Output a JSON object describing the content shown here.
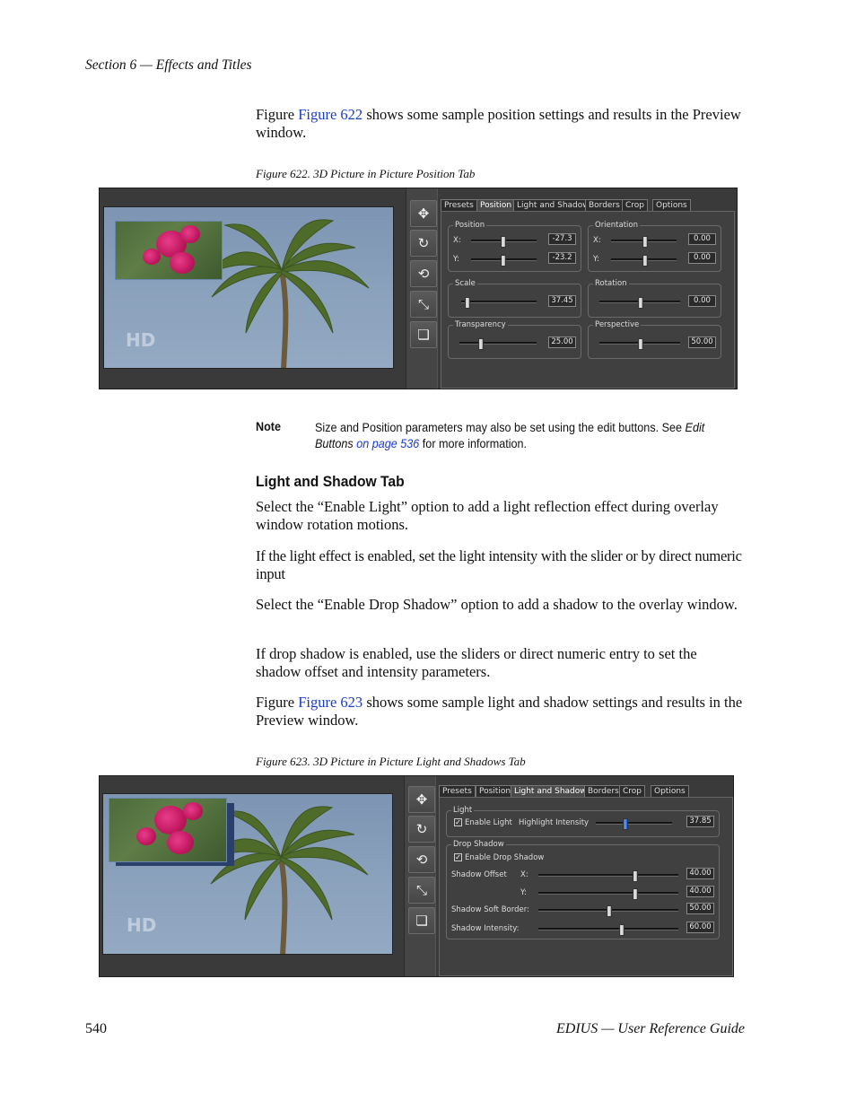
{
  "header": {
    "section": "Section 6 — Effects and Titles"
  },
  "para_fig622": {
    "prefix": "Figure ",
    "link": "Figure 622",
    "rest": " shows some sample position settings and results in the Preview window."
  },
  "fig622_caption": "Figure 622.  3D Picture in Picture Position Tab",
  "fig622": {
    "tabs": [
      "Presets",
      "Position",
      "Light and Shadow",
      "Borders",
      "Crop",
      "Options"
    ],
    "active_tab": "Position",
    "groups": {
      "position": {
        "title": "Position",
        "x_label": "X:",
        "x_value": "-27.3",
        "y_label": "Y:",
        "y_value": "-23.2"
      },
      "orientation": {
        "title": "Orientation",
        "x_label": "X:",
        "x_value": "0.00",
        "y_label": "Y:",
        "y_value": "0.00"
      },
      "scale": {
        "title": "Scale",
        "value": "37.45"
      },
      "rotation": {
        "title": "Rotation",
        "value": "0.00"
      },
      "transparency": {
        "title": "Transparency",
        "value": "25.00"
      },
      "perspective": {
        "title": "Perspective",
        "value": "50.00"
      }
    },
    "logo": "HD",
    "tool_icons": [
      "move-icon",
      "rotate-icon",
      "reset-rotate-icon",
      "fit-icon",
      "window-icon"
    ]
  },
  "note": {
    "label": "Note",
    "text_before": "Size and Position parameters may also be set using the edit buttons. See ",
    "italic": "Edit Buttons",
    "link": "on page 536",
    "text_after": " for more information."
  },
  "subheading": "Light and Shadow Tab",
  "paragraphs": [
    "Select the “Enable Light” option to add a light reflection effect during overlay window rotation motions.",
    "If the light effect is enabled, set the light intensity with the slider or by direct numeric input",
    "Select the “Enable Drop Shadow” option to add a shadow to the overlay window.",
    "If drop shadow is enabled, use the sliders or direct numeric entry to set the shadow offset and intensity parameters."
  ],
  "para_fig623": {
    "prefix": "Figure ",
    "link": "Figure 623",
    "rest": " shows some sample light and shadow settings and results in the Preview window."
  },
  "fig623_caption": "Figure 623.  3D Picture in Picture Light and Shadows Tab",
  "fig623": {
    "tabs": [
      "Presets",
      "Position",
      "Light and Shadow",
      "Borders",
      "Crop",
      "Options"
    ],
    "active_tab": "Light and Shadow",
    "light_title": "Light",
    "enable_light": "Enable Light",
    "highlight_label": "Highlight Intensity",
    "highlight_value": "37.85",
    "drop_title": "Drop Shadow",
    "enable_drop": "Enable Drop Shadow",
    "offset_label": "Shadow Offset",
    "x_label": "X:",
    "x_value": "40.00",
    "y_label": "Y:",
    "y_value": "40.00",
    "soft_label": "Shadow Soft Border:",
    "soft_value": "50.00",
    "intensity_label": "Shadow Intensity:",
    "intensity_value": "60.00",
    "logo": "HD"
  },
  "footer": {
    "page": "540",
    "title": "EDIUS  —  User Reference Guide"
  }
}
